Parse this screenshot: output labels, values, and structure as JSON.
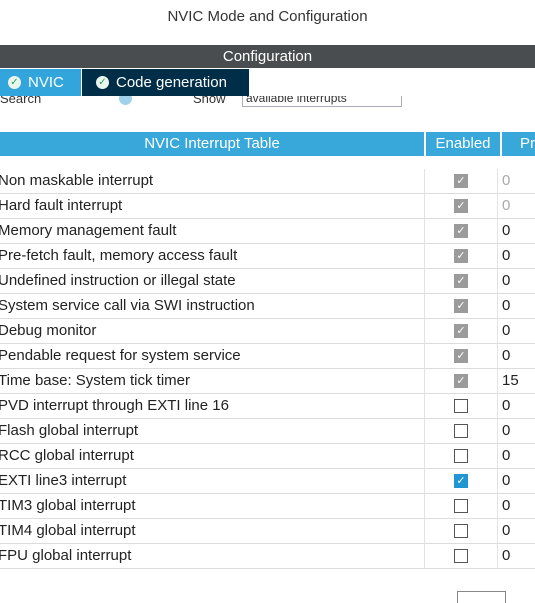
{
  "window": {
    "title": "NVIC Mode and Configuration"
  },
  "config_bar": {
    "label": "Configuration"
  },
  "tabs": [
    {
      "label": "NVIC",
      "icon": "check-circle-icon",
      "active": true
    },
    {
      "label": "Code generation",
      "icon": "check-circle-icon",
      "active": false
    }
  ],
  "filters": {
    "search_label": "Search",
    "show_label": "Show",
    "show_value": "available interrupts"
  },
  "table": {
    "headers": {
      "name": "NVIC Interrupt Table",
      "enabled": "Enabled",
      "priority": "Pr"
    },
    "rows": [
      {
        "name": "Non maskable interrupt",
        "enabled": "locked",
        "priority": "0",
        "priority_dim": true
      },
      {
        "name": "Hard fault interrupt",
        "enabled": "locked",
        "priority": "0",
        "priority_dim": true
      },
      {
        "name": "Memory management fault",
        "enabled": "locked",
        "priority": "0",
        "priority_dim": false
      },
      {
        "name": "Pre-fetch fault, memory access fault",
        "enabled": "locked",
        "priority": "0",
        "priority_dim": false
      },
      {
        "name": "Undefined instruction or illegal state",
        "enabled": "locked",
        "priority": "0",
        "priority_dim": false
      },
      {
        "name": "System service call via SWI instruction",
        "enabled": "locked",
        "priority": "0",
        "priority_dim": false
      },
      {
        "name": "Debug monitor",
        "enabled": "locked",
        "priority": "0",
        "priority_dim": false
      },
      {
        "name": "Pendable request for system service",
        "enabled": "locked",
        "priority": "0",
        "priority_dim": false
      },
      {
        "name": "Time base: System tick timer",
        "enabled": "locked",
        "priority": "15",
        "priority_dim": false
      },
      {
        "name": "PVD interrupt through EXTI line 16",
        "enabled": "off",
        "priority": "0",
        "priority_dim": false
      },
      {
        "name": "Flash global interrupt",
        "enabled": "off",
        "priority": "0",
        "priority_dim": false
      },
      {
        "name": "RCC global interrupt",
        "enabled": "off",
        "priority": "0",
        "priority_dim": false
      },
      {
        "name": "EXTI line3 interrupt",
        "enabled": "on",
        "priority": "0",
        "priority_dim": false
      },
      {
        "name": "TIM3 global interrupt",
        "enabled": "off",
        "priority": "0",
        "priority_dim": false
      },
      {
        "name": "TIM4 global interrupt",
        "enabled": "off",
        "priority": "0",
        "priority_dim": false
      },
      {
        "name": "FPU global interrupt",
        "enabled": "off",
        "priority": "0",
        "priority_dim": false
      }
    ]
  },
  "colors": {
    "accent": "#38a7da",
    "tab_active": "#31a5dc",
    "tab_inactive": "#002d48",
    "config_bar": "#4a4d50",
    "checkbox_on": "#2196d3",
    "checkbox_locked": "#9b9b9b"
  }
}
